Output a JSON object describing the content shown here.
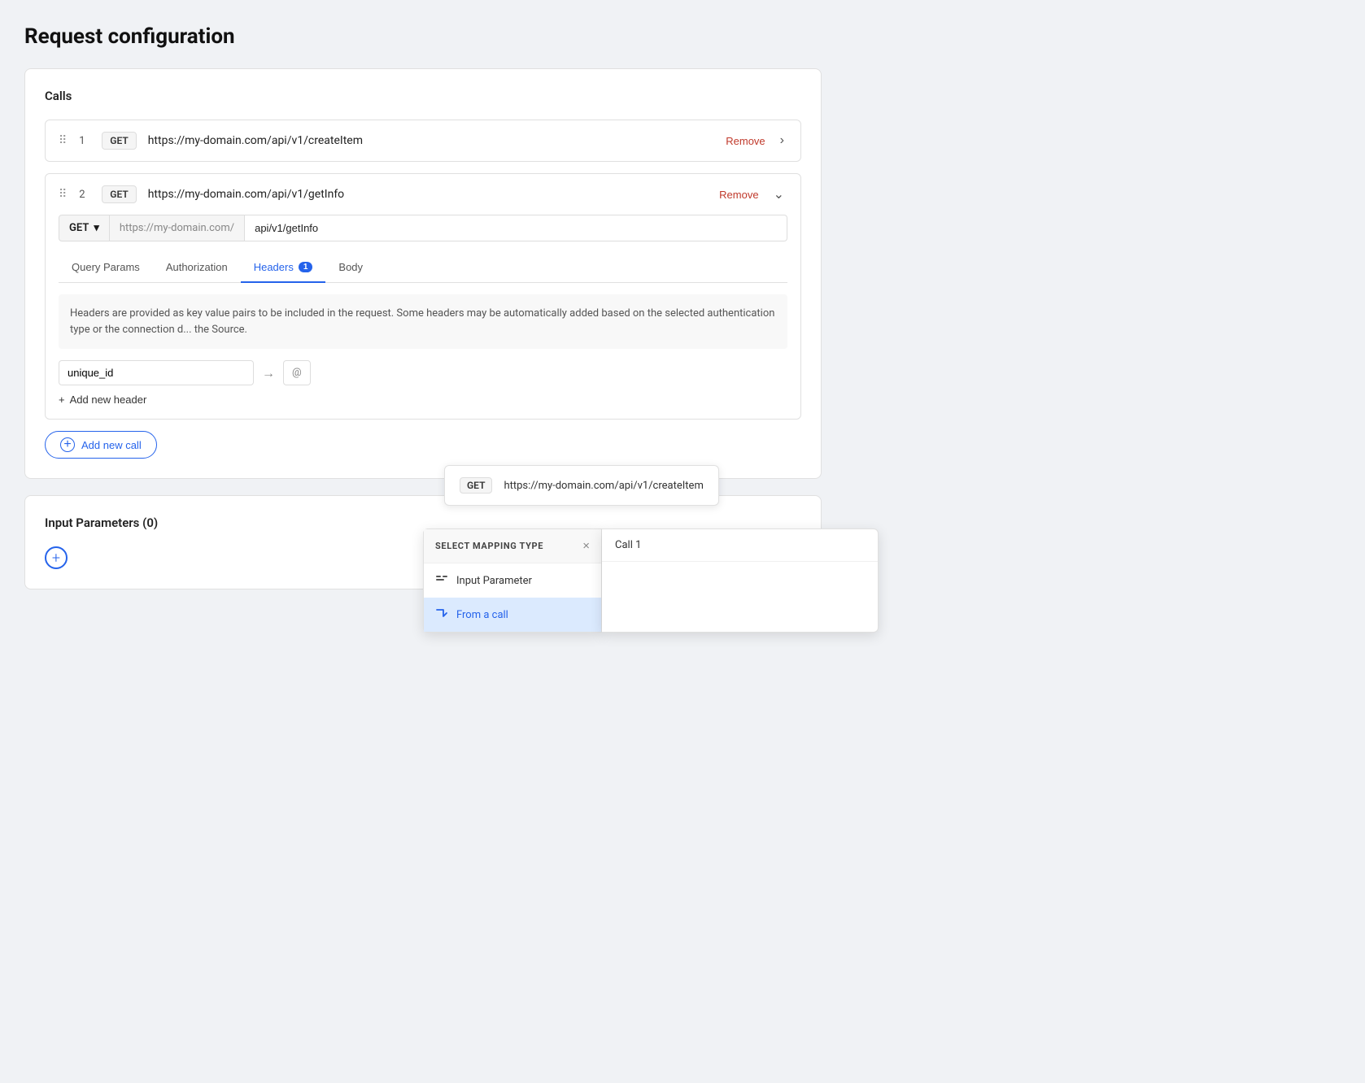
{
  "page": {
    "title": "Request configuration"
  },
  "calls_section": {
    "label": "Calls",
    "calls": [
      {
        "id": 1,
        "number": "1",
        "method": "GET",
        "url": "https://my-domain.com/api/v1/createItem",
        "remove_label": "Remove",
        "expanded": false
      },
      {
        "id": 2,
        "number": "2",
        "method": "GET",
        "url": "https://my-domain.com/api/v1/getInfo",
        "remove_label": "Remove",
        "expanded": true,
        "base_url": "https://my-domain.com/",
        "path": "api/v1/getInfo",
        "tabs": [
          "Query Params",
          "Authorization",
          "Headers",
          "Body"
        ],
        "active_tab": "Headers",
        "headers_badge": "1",
        "headers_info": "Headers are provided as key value pairs to be included in the request. Some headers may be automatically added based on the selected authentication type or the connection d... the Source.",
        "header_key": "unique_id",
        "header_value_placeholder": "@"
      }
    ],
    "add_call_label": "+ Add new call",
    "add_header_label": "+ Add new header"
  },
  "dropdown": {
    "title": "SELECT MAPPING TYPE",
    "close_icon": "×",
    "items": [
      {
        "label": "Input Parameter",
        "icon": "⚏"
      },
      {
        "label": "From a call",
        "icon": "↪",
        "active": true
      }
    ],
    "call_panel_items": [
      {
        "label": "Call 1"
      }
    ]
  },
  "tooltip": {
    "method": "GET",
    "url": "https://my-domain.com/api/v1/createItem"
  },
  "input_params_section": {
    "label": "Input Parameters (0)"
  }
}
